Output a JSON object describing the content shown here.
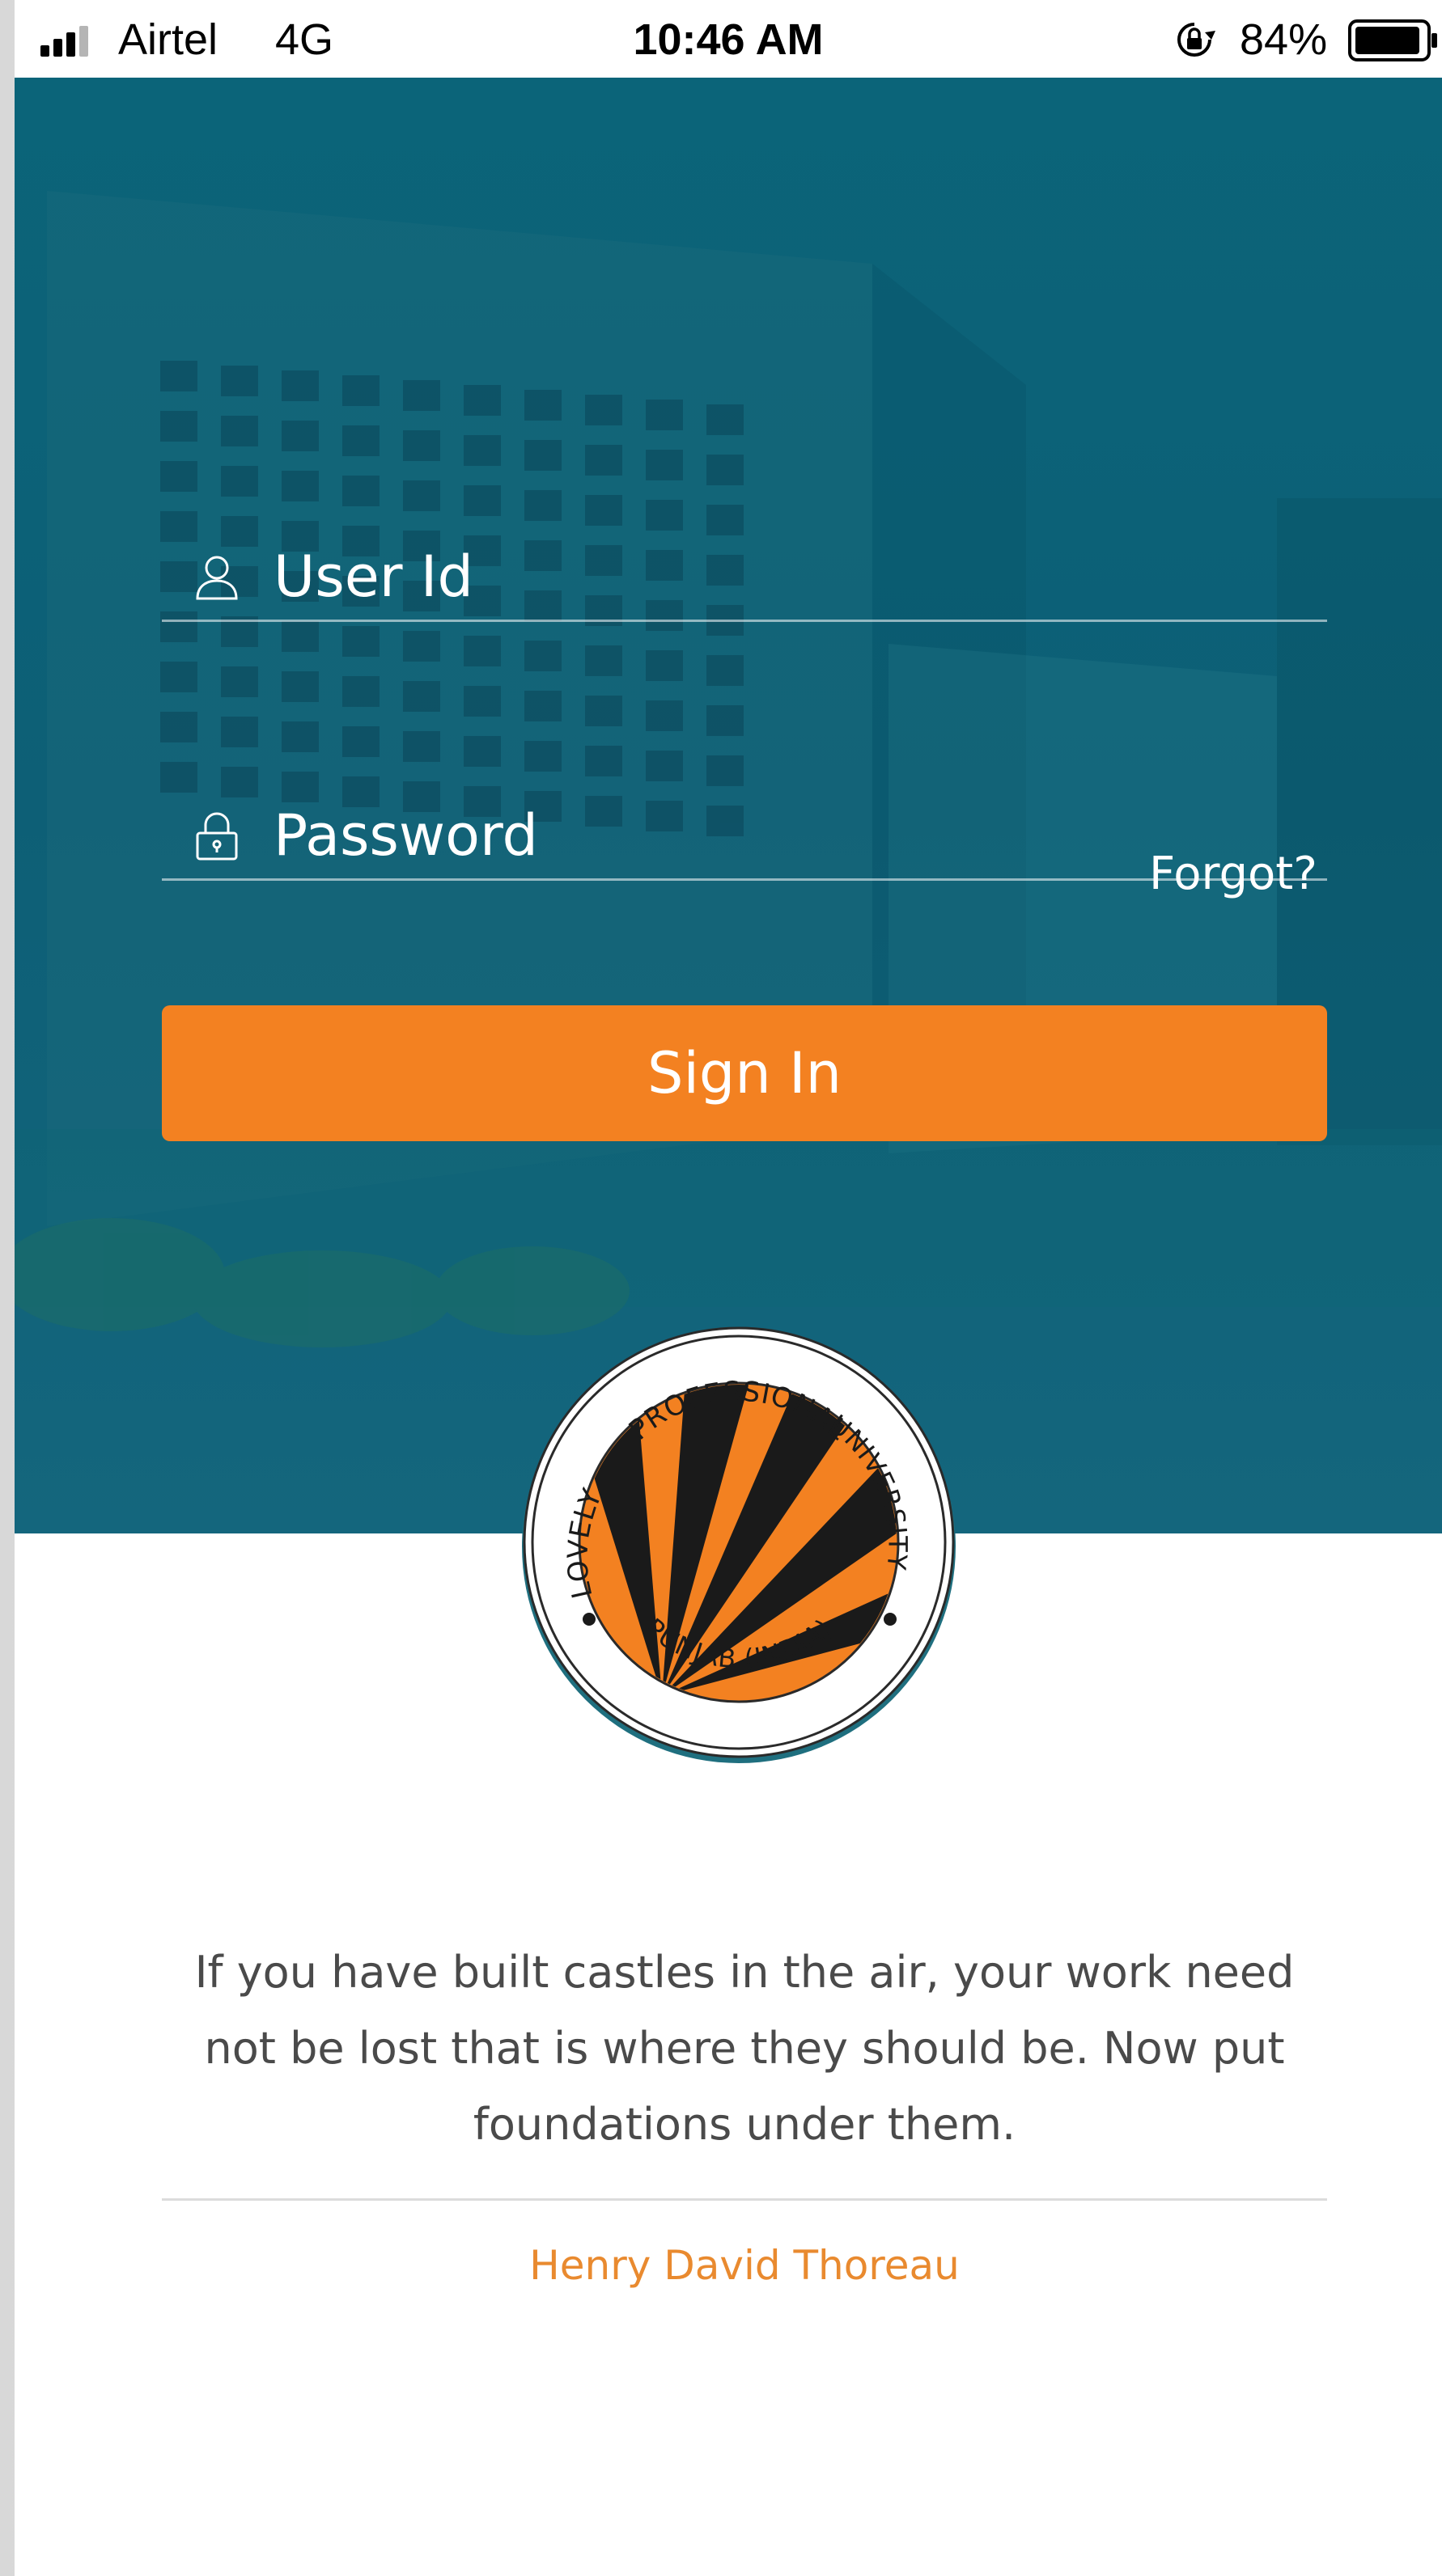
{
  "status_bar": {
    "carrier": "Airtel",
    "network": "4G",
    "time": "10:46 AM",
    "battery_percent": "84%",
    "icons": [
      "signal-icon",
      "orientation-lock-icon",
      "battery-icon"
    ]
  },
  "login": {
    "userid_placeholder": "User Id",
    "password_placeholder": "Password",
    "forgot_label": "Forgot?",
    "signin_label": "Sign In",
    "field_icons": [
      "user-icon",
      "lock-icon"
    ]
  },
  "logo": {
    "top_text": "PROFESSIONAL",
    "left_text": "LOVELY",
    "right_text": "UNIVERSITY",
    "bottom_text": "PUNJAB (INDIA)"
  },
  "quote": {
    "text": "If you have built castles in the air, your work need not be lost that is where they should be. Now put foundations under them.",
    "author": "Henry David Thoreau"
  },
  "colors": {
    "hero_teal": "#0d5f76",
    "accent_orange": "#f38121",
    "author_orange": "#e98a2f",
    "quote_gray": "#4a4a4a"
  }
}
